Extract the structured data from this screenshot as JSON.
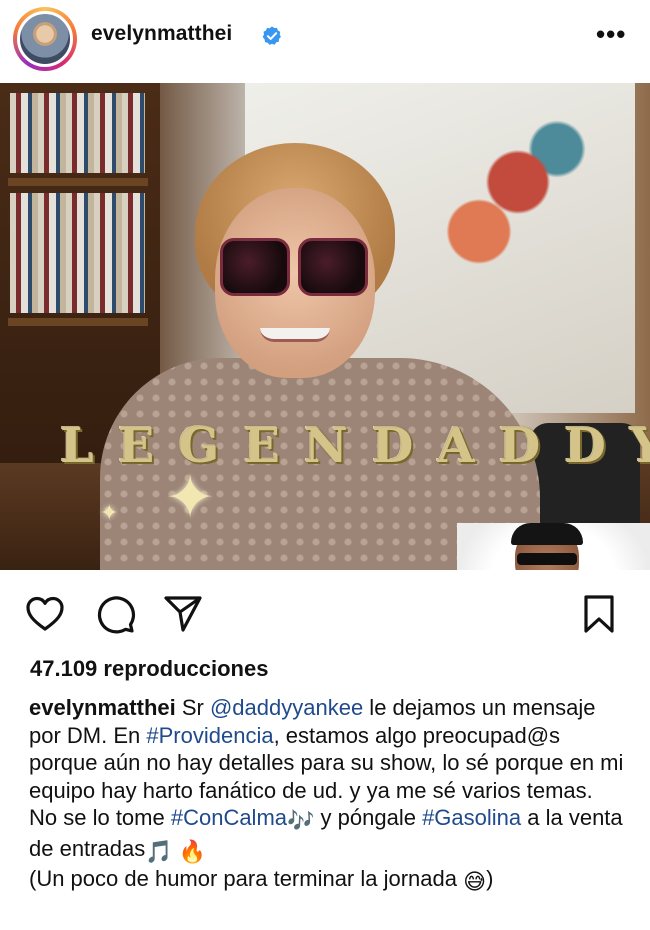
{
  "header": {
    "username": "evelynmatthei",
    "verified_icon": "verified-badge-icon",
    "more_label": "•••"
  },
  "media": {
    "overlay_text": "LEGENDADDY",
    "mute_icon": "speaker-muted-icon"
  },
  "actions": {
    "like_icon": "heart-icon",
    "comment_icon": "comment-icon",
    "share_icon": "send-icon",
    "save_icon": "bookmark-icon"
  },
  "stats": {
    "views": "47.109 reproducciones"
  },
  "caption": {
    "username": "evelynmatthei",
    "t1": " Sr ",
    "mention": "@daddyyankee",
    "t2": " le dejamos un mensaje por DM. En ",
    "tag1": "#Providencia",
    "t3": ", estamos algo preocupad@s porque aún no hay detalles para su show, lo sé porque en mi equipo hay harto fanático de ud. y ya me sé varios temas. No se lo tome ",
    "tag2": "#ConCalma",
    "e1": "🎶",
    "t4": " y póngale ",
    "tag3": "#Gasolina",
    "t5": " a la venta de entradas",
    "e2": "🎵",
    "e3": "🔥",
    "t6": "(Un poco de humor para terminar la jornada ",
    "e4": "😅",
    "t7": ")"
  },
  "colors": {
    "link": "#1f4a8c",
    "verified": "#3897f0",
    "text": "#111111"
  }
}
